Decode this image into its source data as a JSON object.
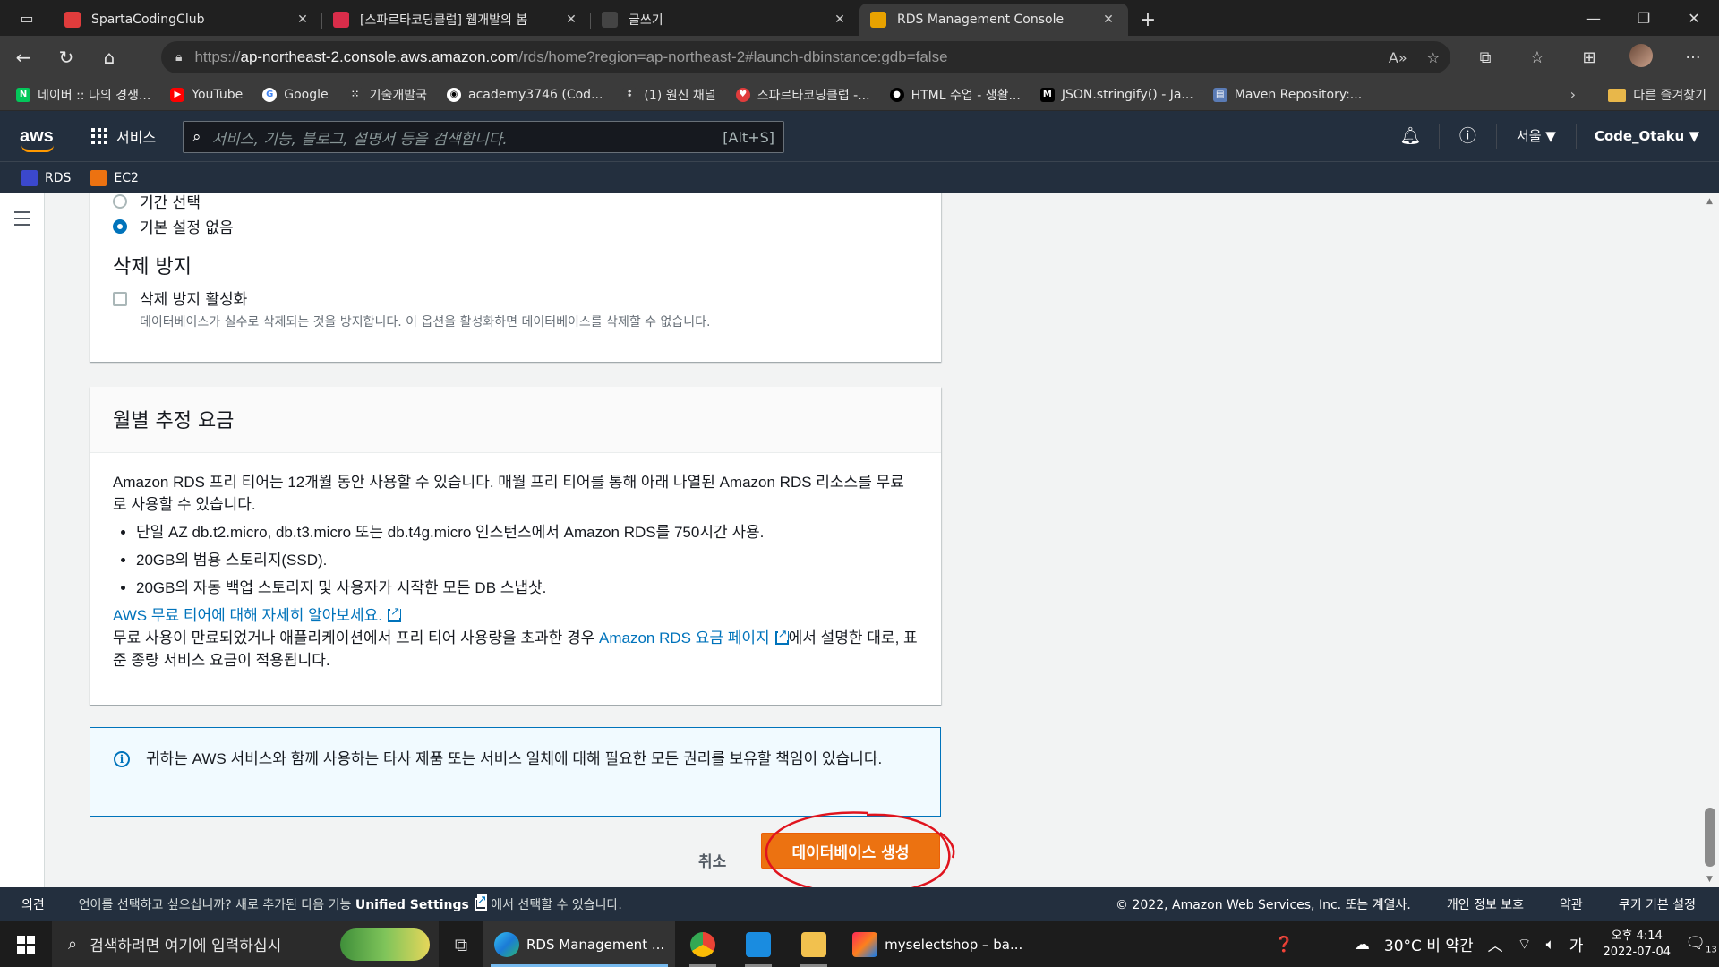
{
  "browser": {
    "tabs": [
      {
        "title": "SpartaCodingClub",
        "color": "#e03c3c"
      },
      {
        "title": "[스파르타코딩클럽] 웹개발의 봄",
        "color": "#d92d4a"
      },
      {
        "title": "글쓰기",
        "color": "#444444"
      },
      {
        "title": "RDS Management Console",
        "color": "#e8a200"
      }
    ],
    "url_prefix": "https://",
    "url_host": "ap-northeast-2.console.aws.amazon.com",
    "url_path": "/rds/home?region=ap-northeast-2#launch-dbinstance:gdb=false",
    "bookmarks": [
      {
        "label": "네이버 :: 나의 경쟁...",
        "color": "#03c75a",
        "glyph": "N"
      },
      {
        "label": "YouTube",
        "color": "#ff0000",
        "glyph": "▶"
      },
      {
        "label": "Google",
        "color": "#ffffff",
        "glyph": "G"
      },
      {
        "label": "기술개발국",
        "color": "#3b3b3b",
        "glyph": "⁙"
      },
      {
        "label": "academy3746 (Cod...",
        "color": "#ffffff",
        "glyph": "◉"
      },
      {
        "label": "(1) 원신 채널",
        "color": "#3b3b3b",
        "glyph": "⁑"
      },
      {
        "label": "스파르타코딩클럽 -...",
        "color": "#e03c3c",
        "glyph": "♥"
      },
      {
        "label": "HTML 수업 - 생활...",
        "color": "#000000",
        "glyph": "●"
      },
      {
        "label": "JSON.stringify() - Ja...",
        "color": "#000000",
        "glyph": "M"
      },
      {
        "label": "Maven Repository:...",
        "color": "#5a7bb5",
        "glyph": "▤"
      }
    ],
    "other_bookmarks": "다른 즐겨찾기"
  },
  "aws": {
    "logo": "aws",
    "services": "서비스",
    "search_placeholder": "서비스, 기능, 블로그, 설명서 등을 검색합니다.",
    "search_shortcut": "[Alt+S]",
    "region": "서울 ▼",
    "account": "Code_Otaku ▼",
    "favorites": [
      {
        "label": "RDS",
        "color": "#3b48cc"
      },
      {
        "label": "EC2",
        "color": "#ec7211"
      }
    ]
  },
  "form": {
    "radio_partial": "기간 선택",
    "radio_none": "기본 설정 없음",
    "deletion_title": "삭제 방지",
    "deletion_checkbox_label": "삭제 방지 활성화",
    "deletion_checkbox_desc": "데이터베이스가 실수로 삭제되는 것을 방지합니다. 이 옵션을 활성화하면 데이터베이스를 삭제할 수 없습니다.",
    "cost_title": "월별 추정 요금",
    "cost_intro": "Amazon RDS 프리 티어는 12개월 동안 사용할 수 있습니다. 매월 프리 티어를 통해 아래 나열된 Amazon RDS 리소스를 무료로 사용할 수 있습니다.",
    "cost_items": [
      "단일 AZ db.t2.micro, db.t3.micro 또는 db.t4g.micro 인스턴스에서 Amazon RDS를 750시간 사용.",
      "20GB의 범용 스토리지(SSD).",
      "20GB의 자동 백업 스토리지 및 사용자가 시작한 모든 DB 스냅샷."
    ],
    "free_tier_link": "AWS 무료 티어에 대해 자세히 알아보세요.",
    "cost_after_pre": "무료 사용이 만료되었거나 애플리케이션에서 프리 티어 사용량을 초과한 경우 ",
    "cost_after_link": "Amazon RDS 요금 페이지",
    "cost_after_post": "에서 설명한 대로, 표준 종량 서비스 요금이 적용됩니다.",
    "info_text": "귀하는 AWS 서비스와 함께 사용하는 타사 제품 또는 서비스 일체에 대해 필요한 모든 권리를 보유할 책임이 있습니다.",
    "cancel": "취소",
    "create": "데이터베이스 생성"
  },
  "footer": {
    "feedback": "의견",
    "lang_pre": "언어를 선택하고 싶으십니까? 새로 추가된 다음 기능 ",
    "lang_link": "Unified Settings",
    "lang_post": " 에서 선택할 수 있습니다.",
    "copyright": "© 2022, Amazon Web Services, Inc. 또는 계열사.",
    "privacy": "개인 정보 보호",
    "terms": "약관",
    "cookies": "쿠키 기본 설정"
  },
  "taskbar": {
    "search": "검색하려면 여기에 입력하십시",
    "app_edge": "RDS Management ...",
    "app_intellij": "myselectshop – ba...",
    "weather": "30°C  비 약간",
    "ime": "가",
    "time": "오후 4:14",
    "date": "2022-07-04",
    "notifications": "13"
  }
}
